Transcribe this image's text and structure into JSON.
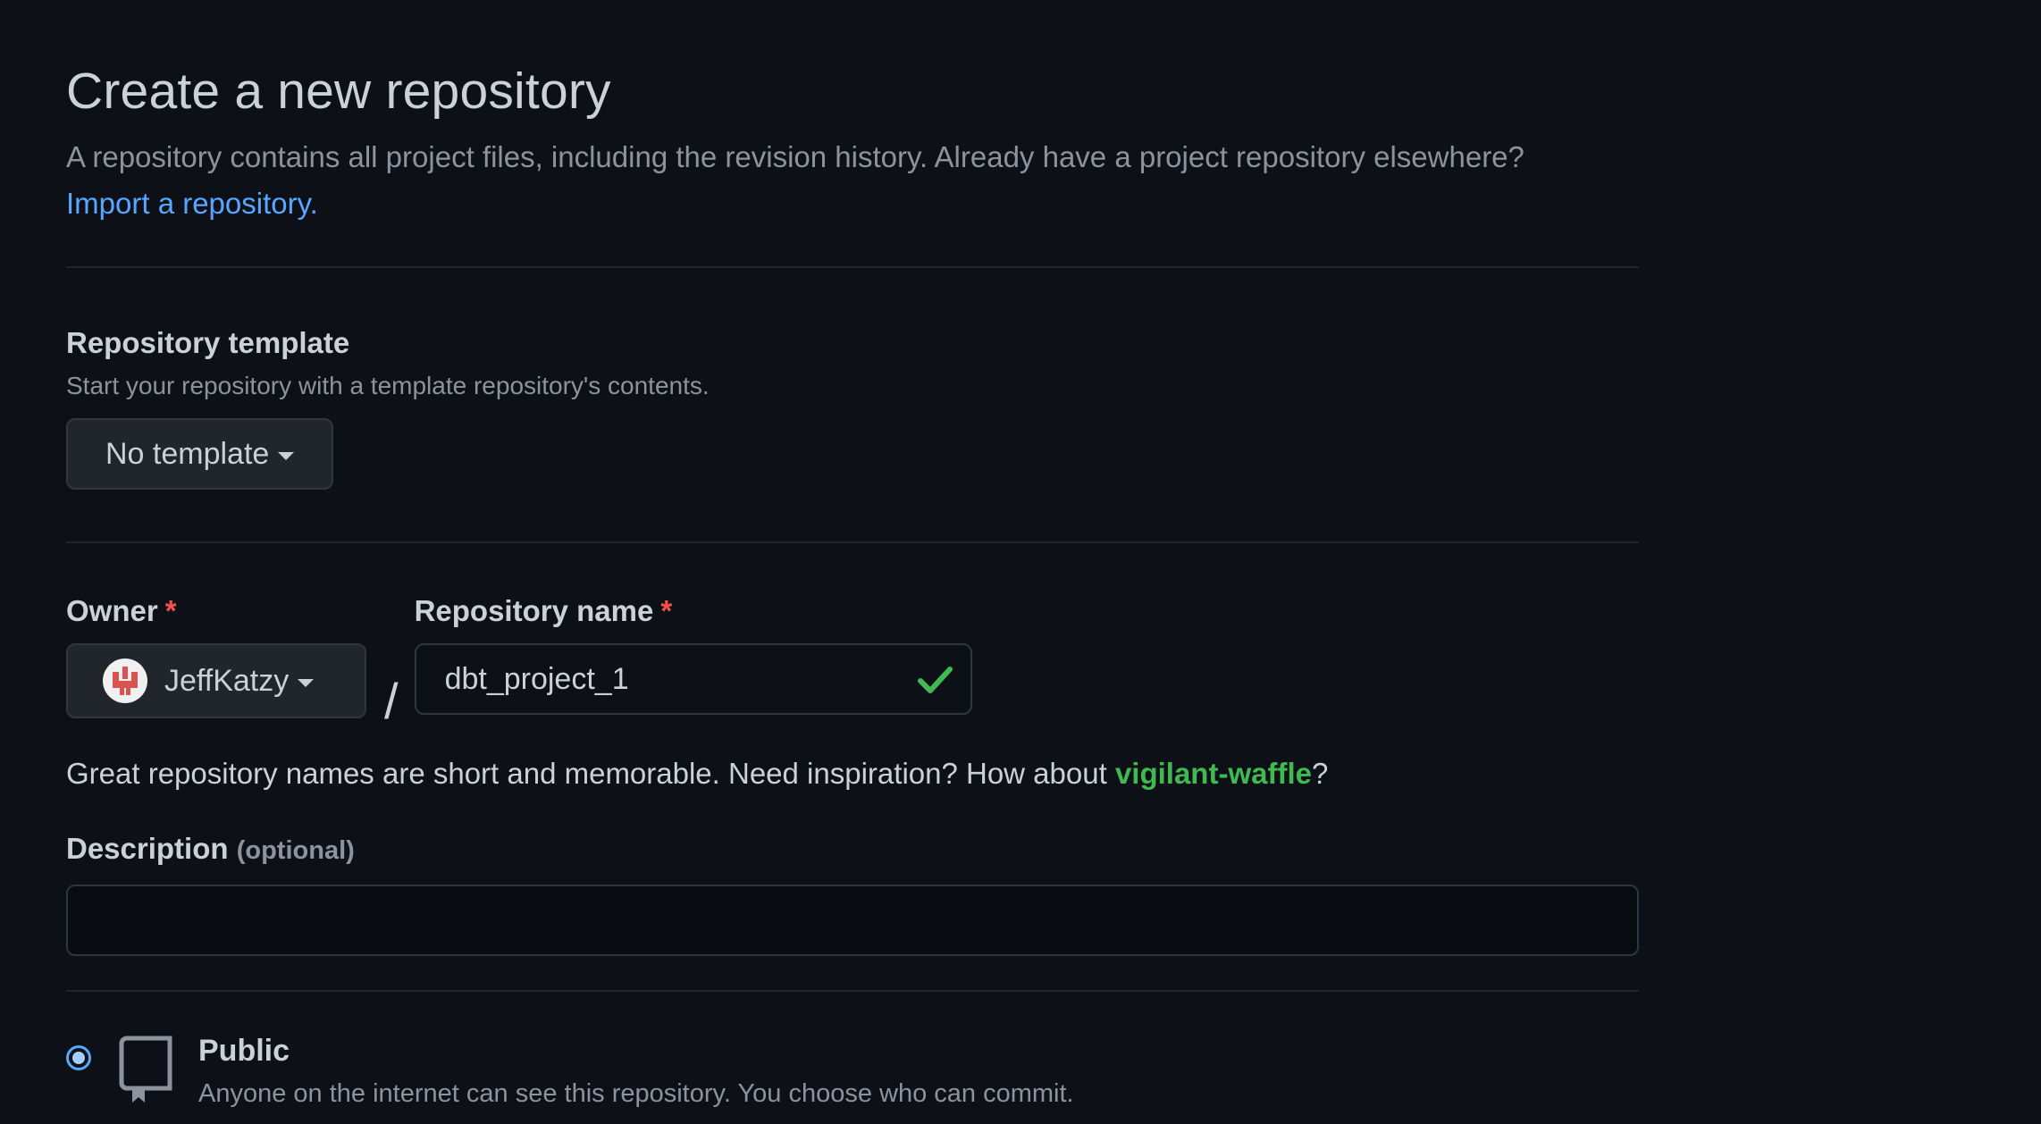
{
  "header": {
    "title": "Create a new repository",
    "subtitle": "A repository contains all project files, including the revision history. Already have a project repository elsewhere?",
    "import_link": "Import a repository."
  },
  "template": {
    "label": "Repository template",
    "note": "Start your repository with a template repository's contents.",
    "button_label": "No template"
  },
  "owner": {
    "label": "Owner",
    "required_mark": "*",
    "selected": "JeffKatzy"
  },
  "separator": "/",
  "repo_name": {
    "label": "Repository name",
    "required_mark": "*",
    "value": "dbt_project_1",
    "valid": true
  },
  "name_hint": {
    "prefix": "Great repository names are short and memorable. Need inspiration? How about ",
    "suggestion": "vigilant-waffle",
    "suffix": "?"
  },
  "description": {
    "label": "Description",
    "optional": "(optional)",
    "value": ""
  },
  "visibility": {
    "public": {
      "label": "Public",
      "note": "Anyone on the internet can see this repository. You choose who can commit.",
      "selected": true
    }
  },
  "colors": {
    "background": "#0d1117",
    "link": "#58a6ff",
    "success": "#3fb950",
    "required": "#f85149"
  },
  "icons": [
    "caret-down-icon",
    "avatar-icon",
    "check-icon",
    "repo-icon",
    "radio-icon"
  ]
}
